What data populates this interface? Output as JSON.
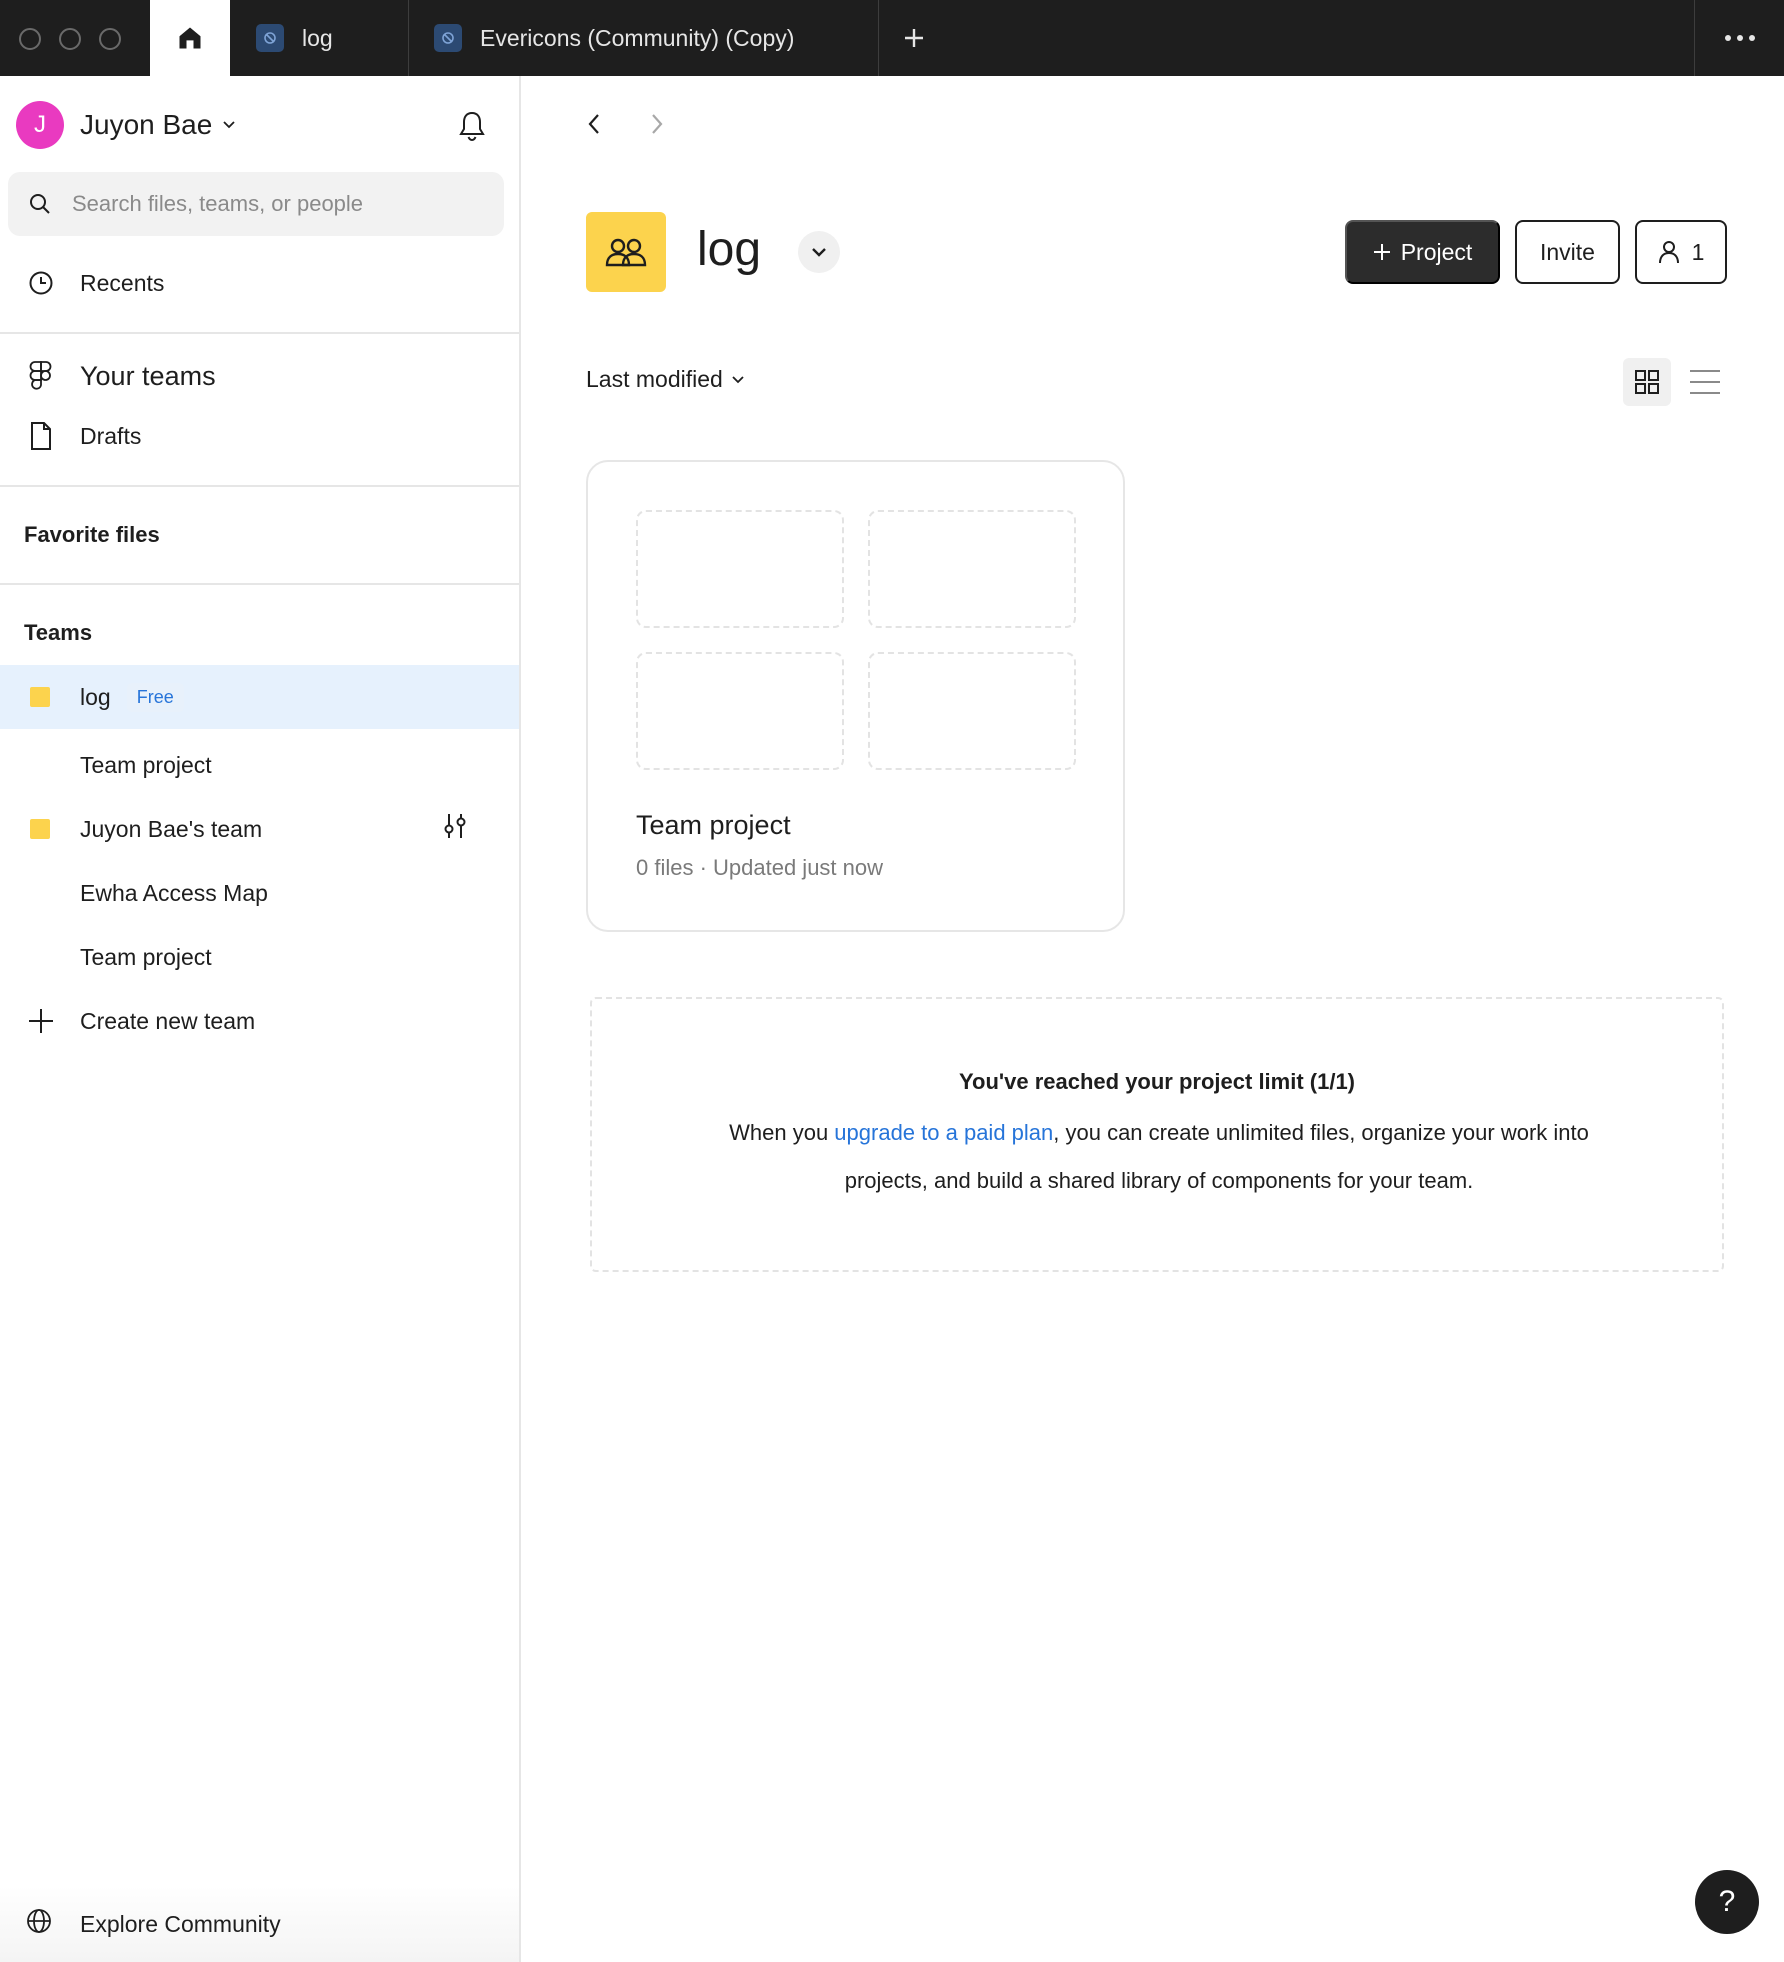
{
  "tabs": {
    "home_label": "",
    "file_tab_1": "log",
    "file_tab_2": "Evericons (Community) (Copy)"
  },
  "sidebar": {
    "user_initial": "J",
    "user_name": "Juyon Bae",
    "search_placeholder": "Search files, teams, or people",
    "recents": "Recents",
    "your_teams": "Your teams",
    "drafts": "Drafts",
    "favorite_files": "Favorite files",
    "teams_heading": "Teams",
    "teams": [
      {
        "name": "log",
        "badge": "Free"
      },
      {
        "name": "Team project"
      },
      {
        "name": "Juyon Bae's team"
      },
      {
        "name": "Ewha Access Map"
      },
      {
        "name": "Team project"
      }
    ],
    "create_team": "Create new team",
    "explore": "Explore Community"
  },
  "main": {
    "team_title": "log",
    "project_button": "Project",
    "invite_button": "Invite",
    "members_count": "1",
    "sort_label": "Last modified",
    "project_card": {
      "title": "Team project",
      "meta": "0 files · Updated just now"
    },
    "limit": {
      "title": "You've reached your project limit (1/1)",
      "body_before": "When you ",
      "link": "upgrade to a paid plan",
      "body_after": ", you can create unlimited files, organize your work into projects, and build a shared library of components for your team."
    },
    "help": "?"
  },
  "colors": {
    "titlebar": "#1e1e1e",
    "accent_link": "#2674d9",
    "team_yellow": "#fcd34d",
    "avatar": "#e93ac0",
    "selected_row": "#e6f1fd"
  }
}
